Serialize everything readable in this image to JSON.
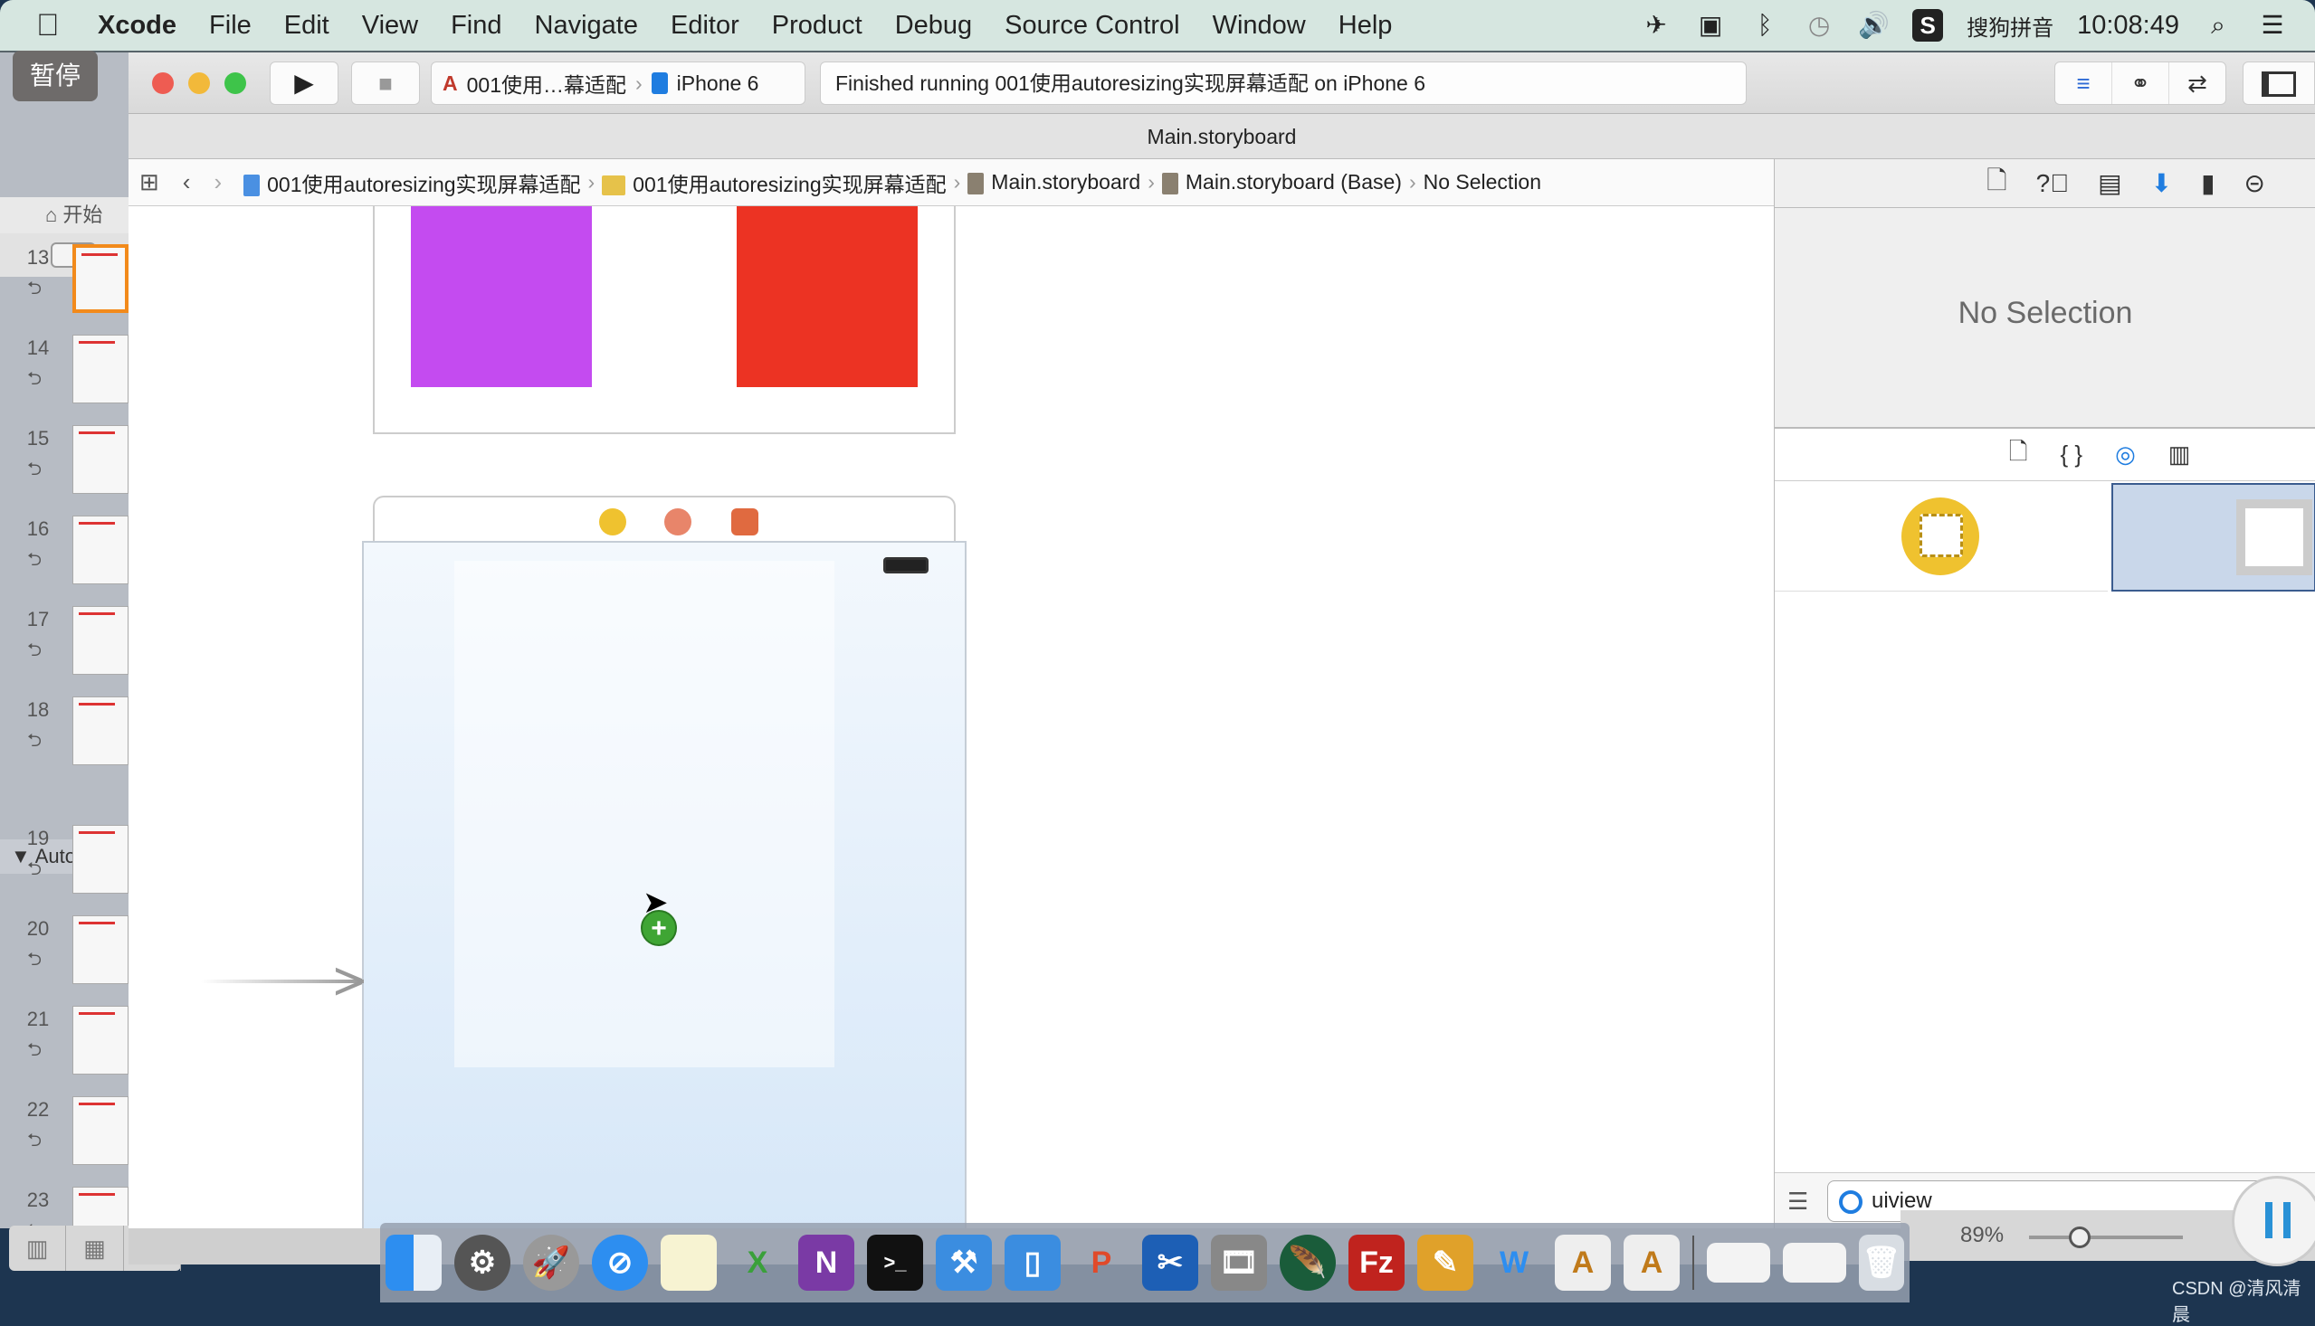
{
  "menubar": {
    "app": "Xcode",
    "items": [
      "File",
      "Edit",
      "View",
      "Find",
      "Navigate",
      "Editor",
      "Product",
      "Debug",
      "Source Control",
      "Window",
      "Help"
    ],
    "input_method": "搜狗拼音",
    "ime_badge": "S",
    "clock": "10:08:49"
  },
  "keynote": {
    "pause_label": "暂停",
    "start_label": "开始",
    "section_label": "Autola…局",
    "slides": [
      {
        "n": "13",
        "selected": true
      },
      {
        "n": "14"
      },
      {
        "n": "15"
      },
      {
        "n": "16"
      },
      {
        "n": "17"
      },
      {
        "n": "18"
      },
      {
        "n": "19"
      },
      {
        "n": "20"
      },
      {
        "n": "21"
      },
      {
        "n": "22"
      },
      {
        "n": "23"
      }
    ]
  },
  "toolbar": {
    "scheme": "001使用…幕适配",
    "device": "iPhone 6",
    "status": "Finished running 001使用autoresizing实现屏幕适配 on iPhone 6"
  },
  "window_title": "Main.storyboard",
  "jumpbar": {
    "crumbs": [
      "001使用autoresizing实现屏幕适配",
      "001使用autoresizing实现屏幕适配",
      "Main.storyboard",
      "Main.storyboard (Base)",
      "No Selection"
    ]
  },
  "colors": {
    "purple_view": "#c44bf0",
    "red_view": "#ec3323",
    "accent": "#1f7de0"
  },
  "inspector": {
    "no_selection": "No Selection"
  },
  "library": {
    "filter_value": "uiview"
  },
  "canvas_zoom": "89%",
  "watermark": "CSDN @清风清晨"
}
